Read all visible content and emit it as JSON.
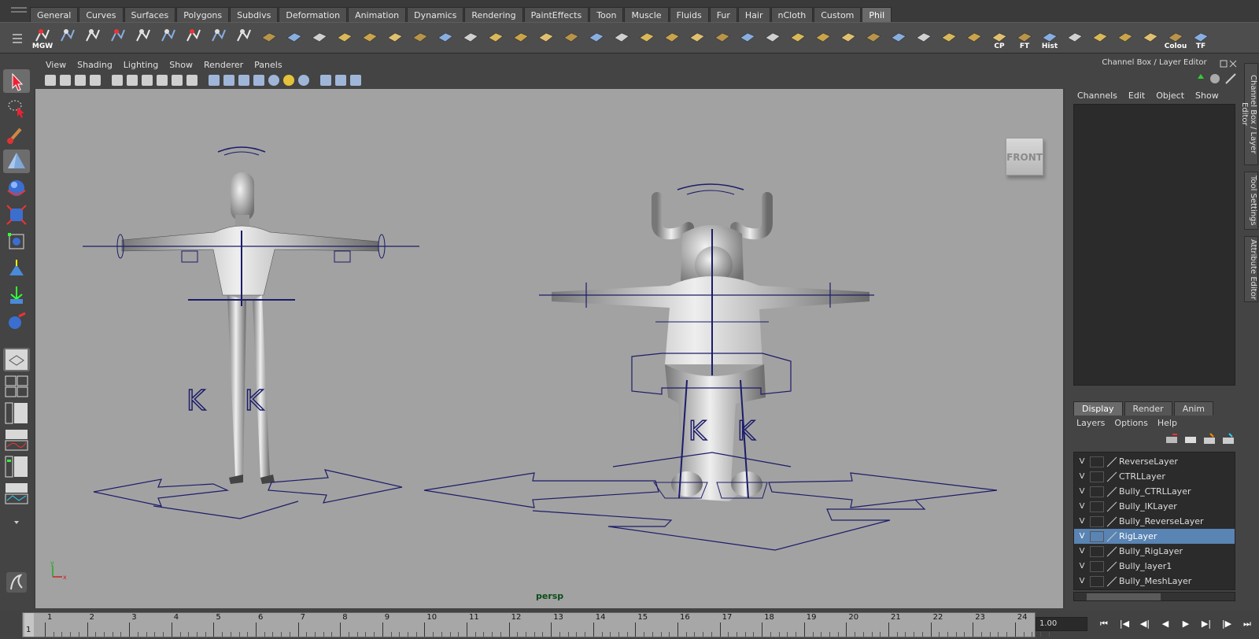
{
  "shelf_tabs": [
    "General",
    "Curves",
    "Surfaces",
    "Polygons",
    "Subdivs",
    "Deformation",
    "Animation",
    "Dynamics",
    "Rendering",
    "PaintEffects",
    "Toon",
    "Muscle",
    "Fluids",
    "Fur",
    "Hair",
    "nCloth",
    "Custom",
    "Phil"
  ],
  "shelf_active_tab": "Phil",
  "shelf_icon_labels": {
    "mgw": "MGW",
    "cp": "CP",
    "ft": "FT",
    "hist": "Hist",
    "colour": "Colou",
    "tf": "TF"
  },
  "viewport": {
    "menu": [
      "View",
      "Shading",
      "Lighting",
      "Show",
      "Renderer",
      "Panels"
    ],
    "camera": "persp",
    "viewcube_label": "FRONT"
  },
  "right_panel": {
    "title": "Channel Box / Layer Editor",
    "menu": [
      "Channels",
      "Edit",
      "Object",
      "Show"
    ],
    "layer_tabs": [
      "Display",
      "Render",
      "Anim"
    ],
    "active_layer_tab": "Display",
    "layer_menu": [
      "Layers",
      "Options",
      "Help"
    ],
    "layers": [
      {
        "v": "V",
        "name": "ReverseLayer"
      },
      {
        "v": "V",
        "name": "CTRLLayer"
      },
      {
        "v": "V",
        "name": "Bully_CTRLLayer"
      },
      {
        "v": "V",
        "name": "Bully_IKLayer"
      },
      {
        "v": "V",
        "name": "Bully_ReverseLayer"
      },
      {
        "v": "V",
        "name": "RigLayer"
      },
      {
        "v": "V",
        "name": "Bully_RigLayer"
      },
      {
        "v": "V",
        "name": "Bully_layer1"
      },
      {
        "v": "V",
        "name": "Bully_MeshLayer"
      }
    ],
    "selected_layer": "RigLayer"
  },
  "side_tabs": [
    "Channel Box / Layer Editor",
    "Tool Settings",
    "Attribute Editor"
  ],
  "timeline": {
    "ticks": [
      "1",
      "2",
      "3",
      "4",
      "5",
      "6",
      "7",
      "8",
      "9",
      "10",
      "11",
      "12",
      "13",
      "14",
      "15",
      "16",
      "17",
      "18",
      "19",
      "20",
      "21",
      "22",
      "23",
      "24"
    ],
    "current_frame": "1",
    "frame_value": "1.00"
  },
  "colors": {
    "viewport_bg": "#a2a2a2",
    "rig_lines": "#1c1c6a",
    "selection": "#5a84b3"
  }
}
